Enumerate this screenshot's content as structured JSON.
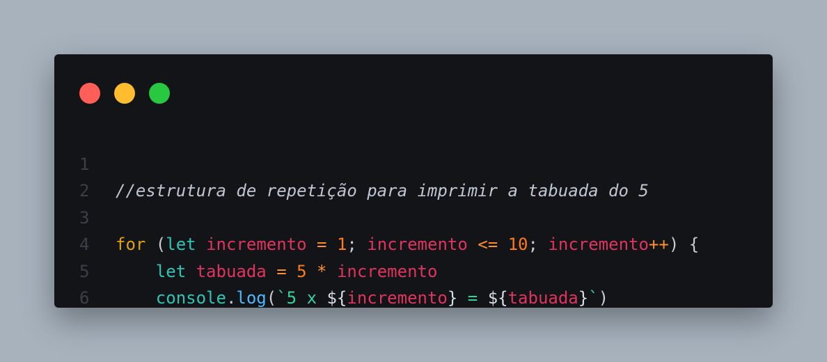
{
  "window": {
    "colors": {
      "background": "#121418",
      "page": "#a7b2bd",
      "close": "#ff5f57",
      "minimize": "#febc2e",
      "maximize": "#28c840"
    }
  },
  "code": {
    "lines": [
      {
        "number": "1",
        "tokens": [
          {
            "text": "//estrutura de repetição para imprimir a tabuada do 5",
            "kind": "comment"
          }
        ]
      },
      {
        "number": "2",
        "tokens": []
      },
      {
        "number": "3",
        "tokens": [
          {
            "text": "for",
            "kind": "kw2"
          },
          {
            "text": " (",
            "kind": "punc"
          },
          {
            "text": "let",
            "kind": "kw"
          },
          {
            "text": " ",
            "kind": "punc"
          },
          {
            "text": "incremento",
            "kind": "var"
          },
          {
            "text": " ",
            "kind": "punc"
          },
          {
            "text": "=",
            "kind": "op"
          },
          {
            "text": " ",
            "kind": "punc"
          },
          {
            "text": "1",
            "kind": "num"
          },
          {
            "text": "; ",
            "kind": "punc"
          },
          {
            "text": "incremento",
            "kind": "var"
          },
          {
            "text": " ",
            "kind": "punc"
          },
          {
            "text": "<=",
            "kind": "op"
          },
          {
            "text": " ",
            "kind": "punc"
          },
          {
            "text": "10",
            "kind": "num"
          },
          {
            "text": "; ",
            "kind": "punc"
          },
          {
            "text": "incremento",
            "kind": "var"
          },
          {
            "text": "++",
            "kind": "op"
          },
          {
            "text": ") {",
            "kind": "punc"
          }
        ]
      },
      {
        "number": "4",
        "tokens": [
          {
            "text": "    ",
            "kind": "punc"
          },
          {
            "text": "let",
            "kind": "kw"
          },
          {
            "text": " ",
            "kind": "punc"
          },
          {
            "text": "tabuada",
            "kind": "var"
          },
          {
            "text": " ",
            "kind": "punc"
          },
          {
            "text": "=",
            "kind": "op"
          },
          {
            "text": " ",
            "kind": "punc"
          },
          {
            "text": "5",
            "kind": "num"
          },
          {
            "text": " ",
            "kind": "punc"
          },
          {
            "text": "*",
            "kind": "op"
          },
          {
            "text": " ",
            "kind": "punc"
          },
          {
            "text": "incremento",
            "kind": "var"
          }
        ]
      },
      {
        "number": "5",
        "tokens": [
          {
            "text": "    ",
            "kind": "punc"
          },
          {
            "text": "console",
            "kind": "kw"
          },
          {
            "text": ".",
            "kind": "punc"
          },
          {
            "text": "log",
            "kind": "fn"
          },
          {
            "text": "(",
            "kind": "punc"
          },
          {
            "text": "`5 x ",
            "kind": "str"
          },
          {
            "text": "${",
            "kind": "tmpl"
          },
          {
            "text": "incremento",
            "kind": "var"
          },
          {
            "text": "}",
            "kind": "tmpl"
          },
          {
            "text": " = ",
            "kind": "str"
          },
          {
            "text": "${",
            "kind": "tmpl"
          },
          {
            "text": "tabuada",
            "kind": "var"
          },
          {
            "text": "}",
            "kind": "tmpl"
          },
          {
            "text": "`",
            "kind": "str"
          },
          {
            "text": ")",
            "kind": "punc"
          }
        ]
      },
      {
        "number": "6",
        "tokens": [
          {
            "text": "}",
            "kind": "punc"
          }
        ]
      }
    ]
  }
}
